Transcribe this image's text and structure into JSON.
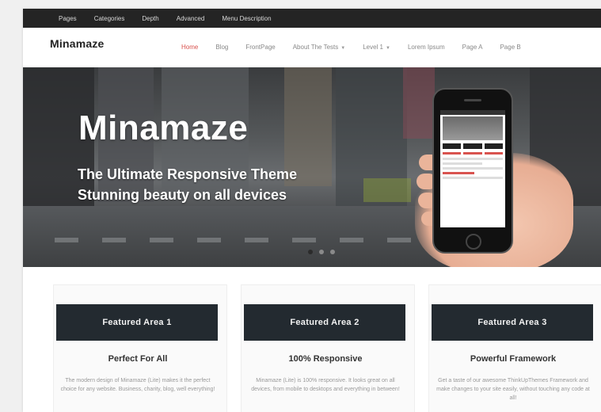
{
  "topbar": {
    "links": [
      "Pages",
      "Categories",
      "Depth",
      "Advanced",
      "Menu Description"
    ]
  },
  "header": {
    "logo": "Minamaze",
    "nav": [
      {
        "label": "Home",
        "active": true,
        "caret": false
      },
      {
        "label": "Blog",
        "active": false,
        "caret": false
      },
      {
        "label": "FrontPage",
        "active": false,
        "caret": false
      },
      {
        "label": "About The Tests",
        "active": false,
        "caret": true
      },
      {
        "label": "Level 1",
        "active": false,
        "caret": true
      },
      {
        "label": "Lorem Ipsum",
        "active": false,
        "caret": false
      },
      {
        "label": "Page A",
        "active": false,
        "caret": false
      },
      {
        "label": "Page B",
        "active": false,
        "caret": false
      }
    ]
  },
  "hero": {
    "title": "Minamaze",
    "subtitle_line1": "The Ultimate Responsive Theme",
    "subtitle_line2": "Stunning beauty on all devices",
    "slides": 3,
    "active_slide": 1
  },
  "features": [
    {
      "button": "Featured Area 1",
      "heading": "Perfect For All",
      "text": "The modern design of Minamaze (Lite) makes it the perfect choice for any website. Business, charity, blog, well everything!"
    },
    {
      "button": "Featured Area 2",
      "heading": "100% Responsive",
      "text": "Minamaze (Lite) is 100% responsive. It looks great on all devices, from mobile to desktops and everything in between!"
    },
    {
      "button": "Featured Area 3",
      "heading": "Powerful Framework",
      "text": "Get a taste of our awesome ThinkUpThemes Framework and make changes to your site easily, without touching any code at all!"
    }
  ],
  "colors": {
    "topbar_bg": "#242424",
    "accent_active": "#d9534f",
    "feature_button_bg": "#232a30"
  }
}
